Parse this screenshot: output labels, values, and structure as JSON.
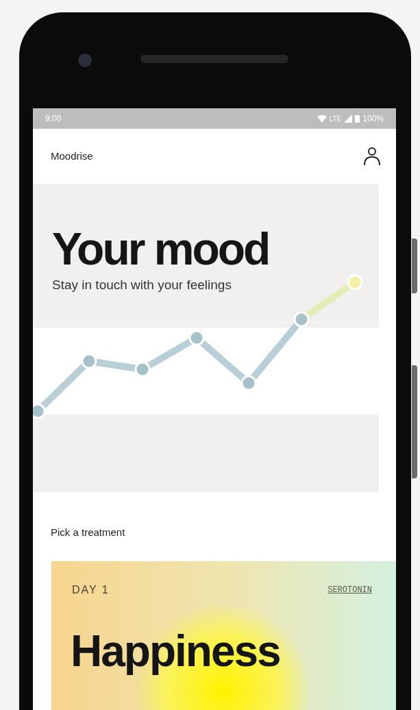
{
  "status_bar": {
    "time": "9:00",
    "network": "LTE",
    "battery": "100%"
  },
  "app_bar": {
    "title": "Moodrise"
  },
  "hero": {
    "title": "Your mood",
    "subtitle": "Stay in touch with your feelings"
  },
  "section": {
    "title": "Pick a treatment"
  },
  "treatment_card": {
    "day": "DAY 1",
    "tag": "SEROTONIN",
    "title": "Happiness"
  }
}
